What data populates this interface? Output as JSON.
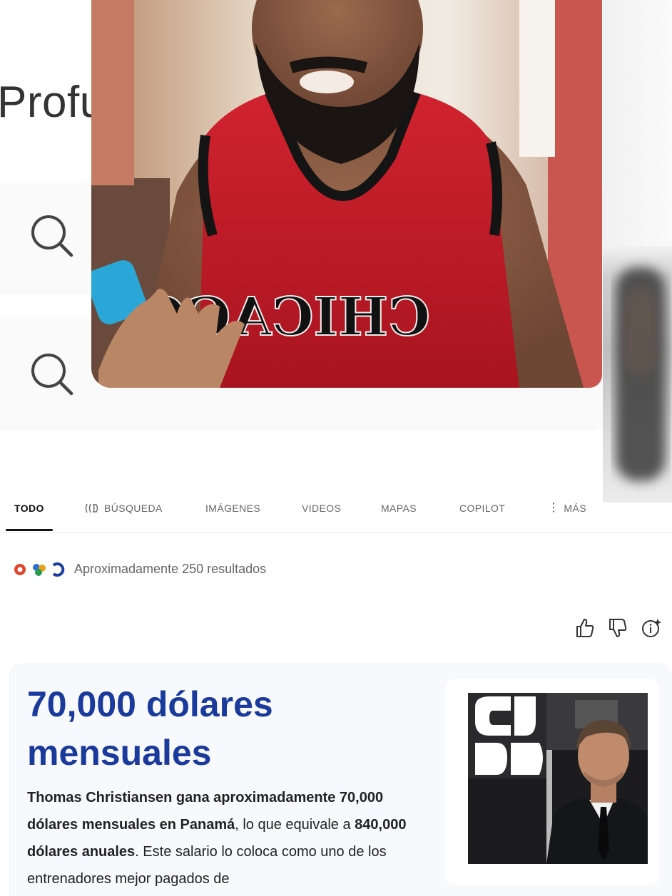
{
  "search": {
    "query_fragment": "Profu"
  },
  "tabs": [
    {
      "label": "TODO",
      "active": true
    },
    {
      "label": "BÚSQUEDA",
      "icon": "copilot-search-icon"
    },
    {
      "label": "IMÁGENES"
    },
    {
      "label": "VIDEOS"
    },
    {
      "label": "MAPAS"
    },
    {
      "label": "COPILOT"
    },
    {
      "label": "MÁS",
      "icon": "more-vertical-icon"
    }
  ],
  "results": {
    "count_text": "Aproximadamente 250 resultados"
  },
  "answer": {
    "title": "70,000 dólares mensuales",
    "body_bold_1": "Thomas Christiansen gana aproximadamente 70,000 dólares mensuales en Panamá",
    "body_text_1": ", lo que equivale a ",
    "body_bold_2": "840,000 dólares anuales",
    "body_text_2": ". Este salario lo coloca como uno de los entrenadores mejor pagados de"
  },
  "webcam": {
    "jersey_text": "CHICAGO"
  },
  "colors": {
    "title_blue": "#1a3a9c",
    "card_bg": "#f8f9fc",
    "jersey_red": "#c4202c"
  }
}
